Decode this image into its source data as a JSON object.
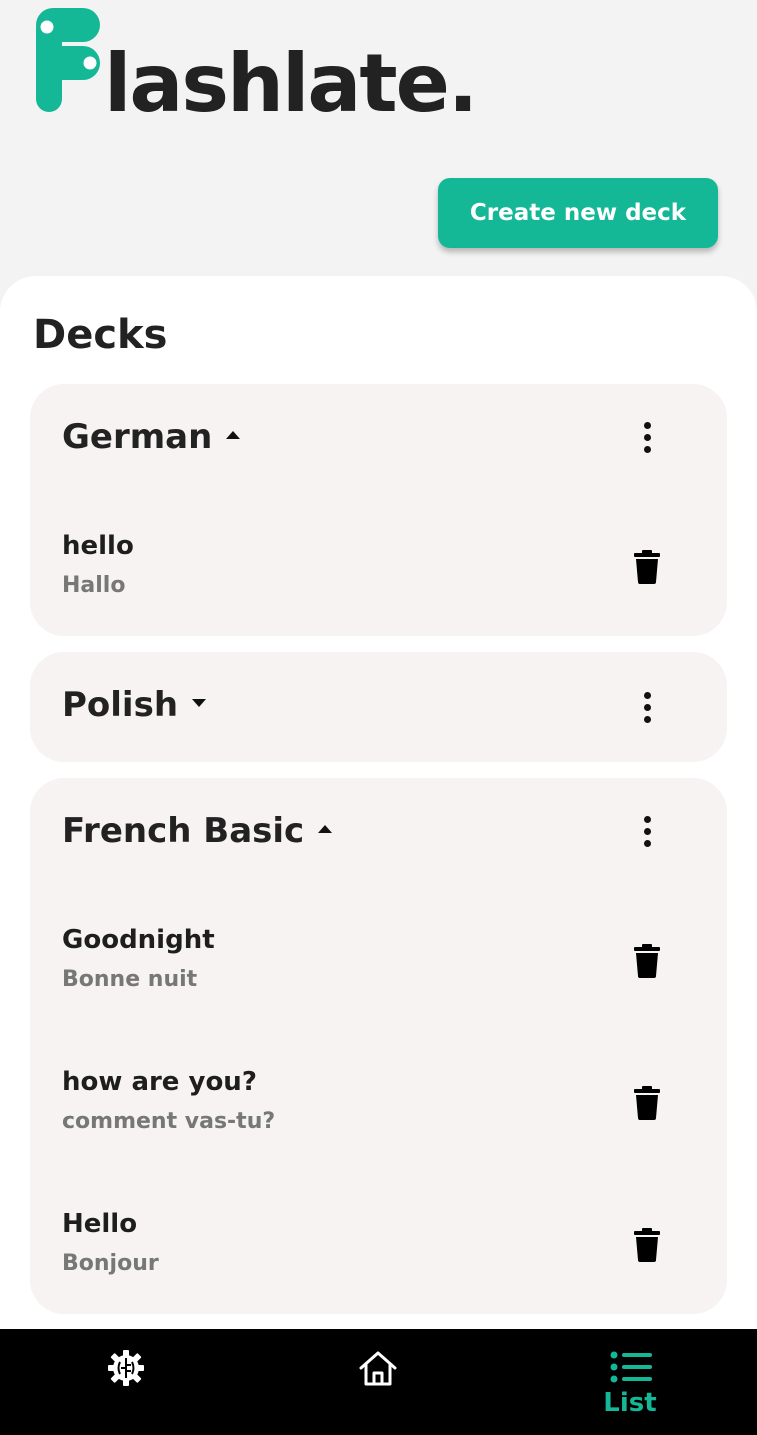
{
  "app": {
    "logo_text": "lashlate.",
    "brand_color": "#14b896"
  },
  "header": {
    "create_button_label": "Create new deck"
  },
  "main": {
    "section_title": "Decks",
    "decks": [
      {
        "name": "German",
        "expanded": true,
        "cards": [
          {
            "front": "hello",
            "back": "Hallo"
          }
        ]
      },
      {
        "name": "Polish",
        "expanded": false,
        "cards": []
      },
      {
        "name": "French Basic",
        "expanded": true,
        "cards": [
          {
            "front": "Goodnight",
            "back": "Bonne nuit"
          },
          {
            "front": "how are you?",
            "back": "comment vas-tu?"
          },
          {
            "front": "Hello",
            "back": "Bonjour"
          }
        ]
      }
    ]
  },
  "nav": {
    "items": [
      {
        "icon": "brain-gear-icon",
        "label": "",
        "active": false
      },
      {
        "icon": "home-icon",
        "label": "",
        "active": false
      },
      {
        "icon": "list-icon",
        "label": "List",
        "active": true
      }
    ]
  }
}
